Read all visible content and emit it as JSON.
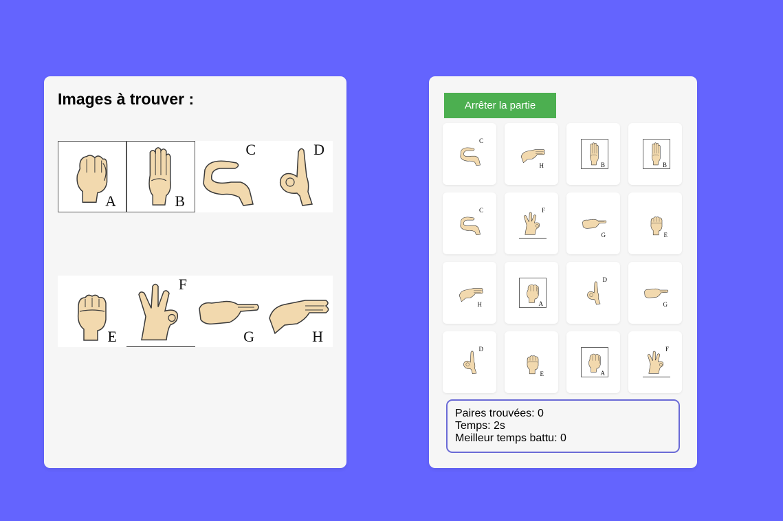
{
  "left_panel": {
    "title": "Images à trouver :",
    "reference_signs": [
      {
        "letter": "A",
        "sign": "fist-thumb-side",
        "frame": "boxed",
        "letter_pos": "br"
      },
      {
        "letter": "B",
        "sign": "flat-hand-up",
        "frame": "boxed",
        "letter_pos": "br"
      },
      {
        "letter": "C",
        "sign": "c-curve",
        "frame": "none",
        "letter_pos": "tr"
      },
      {
        "letter": "D",
        "sign": "index-up",
        "frame": "none",
        "letter_pos": "tr"
      },
      {
        "letter": "E",
        "sign": "curled-fingers",
        "frame": "none",
        "letter_pos": "br"
      },
      {
        "letter": "F",
        "sign": "ok-three-up",
        "frame": "underlined",
        "letter_pos": "tr"
      },
      {
        "letter": "G",
        "sign": "point-side",
        "frame": "none",
        "letter_pos": "br"
      },
      {
        "letter": "H",
        "sign": "two-fingers-side",
        "frame": "none",
        "letter_pos": "br"
      }
    ]
  },
  "right_panel": {
    "stop_button_label": "Arrêter la partie",
    "cards": [
      {
        "letter": "C"
      },
      {
        "letter": "H"
      },
      {
        "letter": "B"
      },
      {
        "letter": "B"
      },
      {
        "letter": "C"
      },
      {
        "letter": "F"
      },
      {
        "letter": "G"
      },
      {
        "letter": "E"
      },
      {
        "letter": "H"
      },
      {
        "letter": "A"
      },
      {
        "letter": "D"
      },
      {
        "letter": "G"
      },
      {
        "letter": "D"
      },
      {
        "letter": "E"
      },
      {
        "letter": "A"
      },
      {
        "letter": "F"
      }
    ],
    "stats": {
      "pairs_found": "Paires trouvées: 0",
      "time": "Temps: 2s",
      "best_time_beaten": "Meilleur temps battu: 0"
    }
  },
  "colors": {
    "background": "#6464fe",
    "panel": "#f6f6f6",
    "button": "#4caf50",
    "stats_border": "#6a6ad6",
    "skin": "#f2d9ae",
    "skin_outline": "#3a3a3a"
  }
}
